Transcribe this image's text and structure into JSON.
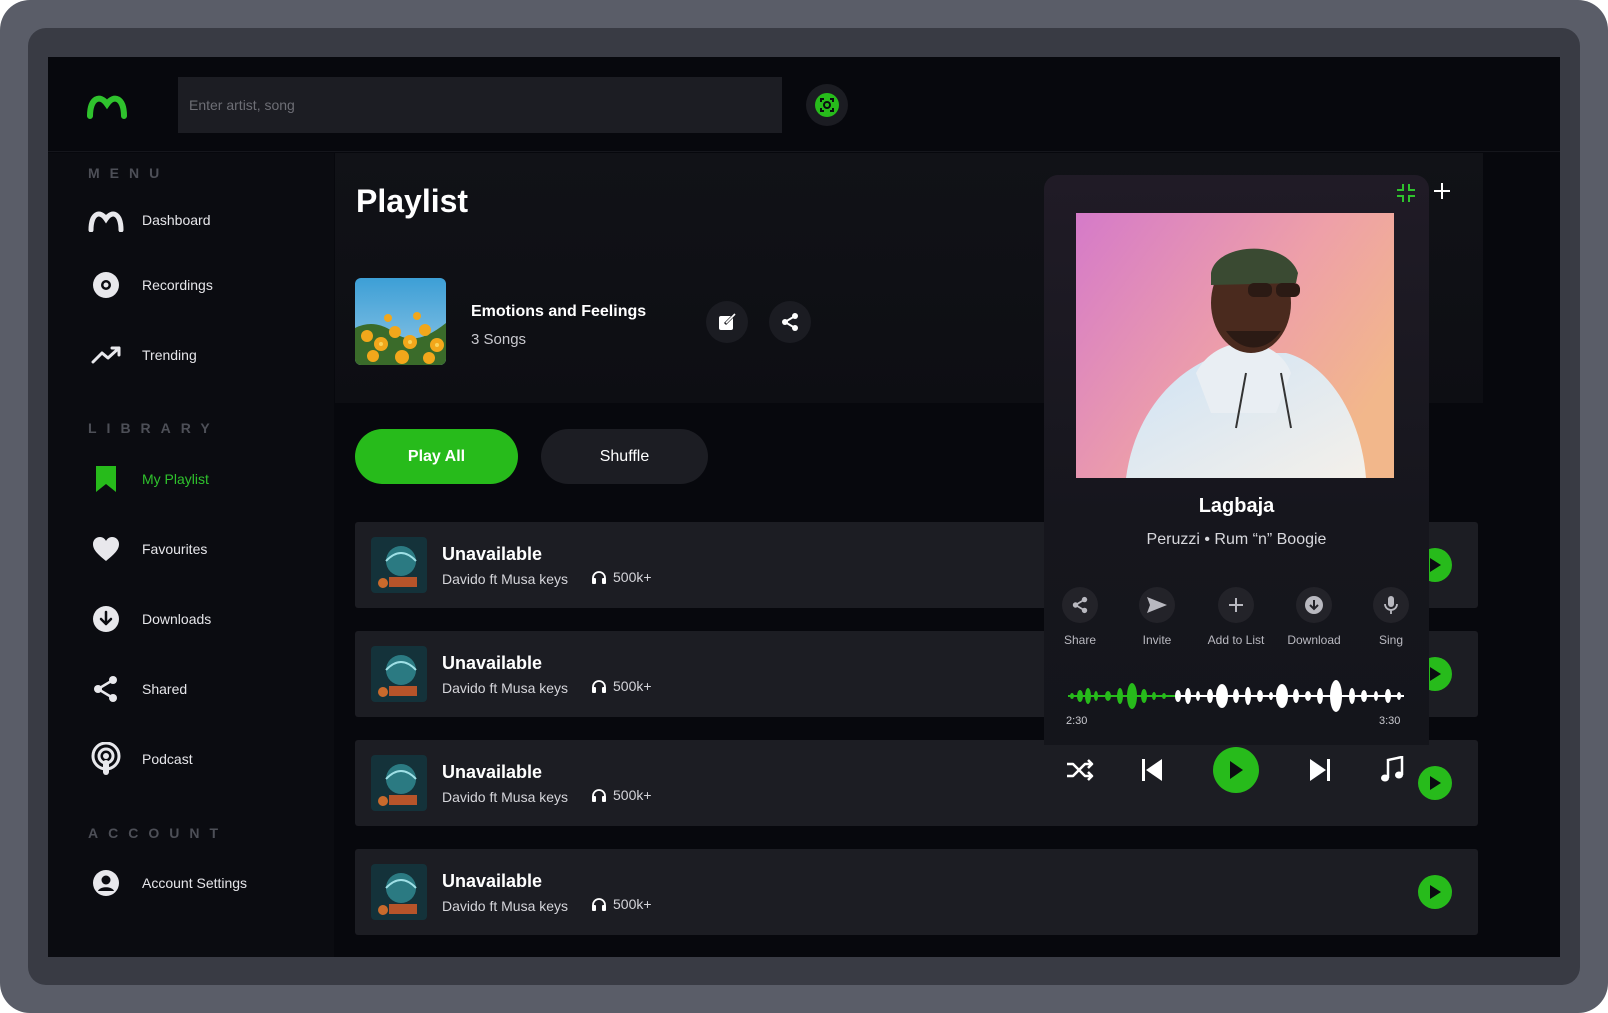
{
  "search": {
    "placeholder": "Enter artist, song"
  },
  "sidebar": {
    "sections": {
      "menu": "MENU",
      "library": "LIBRARY",
      "account": "ACCOUNT"
    },
    "menu_items": [
      {
        "label": "Dashboard",
        "icon": "logo-icon"
      },
      {
        "label": "Recordings",
        "icon": "disc-icon"
      },
      {
        "label": "Trending",
        "icon": "trending-icon"
      }
    ],
    "library_items": [
      {
        "label": "My Playlist",
        "icon": "bookmark-icon",
        "active": true
      },
      {
        "label": "Favourites",
        "icon": "heart-icon"
      },
      {
        "label": "Downloads",
        "icon": "download-icon"
      },
      {
        "label": "Shared",
        "icon": "share-icon"
      },
      {
        "label": "Podcast",
        "icon": "podcast-icon"
      }
    ],
    "account_items": [
      {
        "label": "Account Settings",
        "icon": "user-icon"
      }
    ]
  },
  "main": {
    "title": "Playlist",
    "playlist": {
      "name": "Emotions and Feelings",
      "count": "3 Songs"
    },
    "play_all": "Play All",
    "shuffle": "Shuffle",
    "tracks": [
      {
        "title": "Unavailable",
        "artist": "Davido ft Musa keys",
        "plays": "500k+"
      },
      {
        "title": "Unavailable",
        "artist": "Davido ft Musa keys",
        "plays": "500k+"
      },
      {
        "title": "Unavailable",
        "artist": "Davido ft Musa keys",
        "plays": "500k+"
      },
      {
        "title": "Unavailable",
        "artist": "Davido ft Musa keys",
        "plays": "500k+"
      }
    ]
  },
  "now_playing": {
    "title": "Lagbaja",
    "subtitle": "Peruzzi • Rum “n” Boogie",
    "actions": [
      "Share",
      "Invite",
      "Add to List",
      "Download",
      "Sing"
    ],
    "time_current": "2:30",
    "time_total": "3:30"
  },
  "colors": {
    "accent": "#27bb1b",
    "background": "#07080d",
    "card": "#1c1d23"
  }
}
